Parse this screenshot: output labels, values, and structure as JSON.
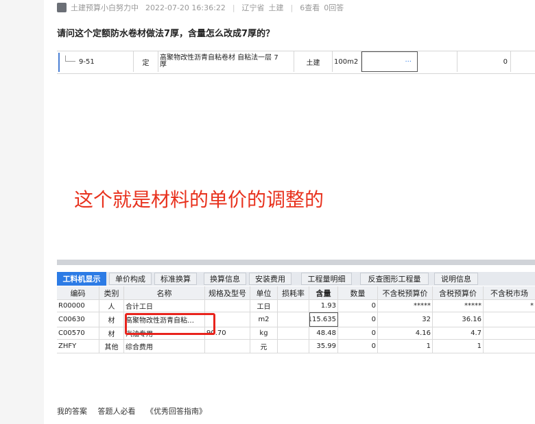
{
  "meta": {
    "author": "土建预算小白努力中",
    "datetime": "2022-07-20 16:36:22",
    "region": "辽宁省",
    "category": "土建",
    "views": "6查看",
    "answers": "0回答"
  },
  "question_title": "请问这个定额防水卷材做法7厚，含量怎么改成7厚的？",
  "top_row": {
    "code": "9-51",
    "type": "定",
    "name_line1": "高聚物改性沥青自粘卷材 自粘法一层 7",
    "name_line2": "厚",
    "trade": "土建",
    "unit": "100m2",
    "ellipsis": "···",
    "value": "0"
  },
  "annotation": "这个就是材料的单价的调整的",
  "tabs": [
    "工料机显示",
    "单价构成",
    "标准换算",
    "换算信息",
    "安装费用",
    "工程量明细",
    "反查图形工程量",
    "说明信息"
  ],
  "table": {
    "headers": [
      "编码",
      "类别",
      "名称",
      "规格及型号",
      "单位",
      "损耗率",
      "含量",
      "数量",
      "不含税预算价",
      "含税预算价",
      "不含税市场"
    ],
    "rows": [
      [
        "R00000",
        "人",
        "合计工日",
        "",
        "工日",
        "",
        "1.93",
        "0",
        "*****",
        "*****",
        "*"
      ],
      [
        "C00630",
        "材",
        "高聚物改性沥青自粘…",
        "",
        "m2",
        "",
        "115.635",
        "0",
        "32",
        "36.16",
        ""
      ],
      [
        "C00570",
        "材",
        "汽油专用",
        "90.70",
        "kg",
        "",
        "48.48",
        "0",
        "4.16",
        "4.7",
        ""
      ],
      [
        "ZHFY",
        "其他",
        "综合费用",
        "",
        "元",
        "",
        "35.99",
        "0",
        "1",
        "1",
        ""
      ]
    ]
  },
  "footer": [
    "我的答案",
    "答题人必看",
    "《优秀回答指南》"
  ]
}
